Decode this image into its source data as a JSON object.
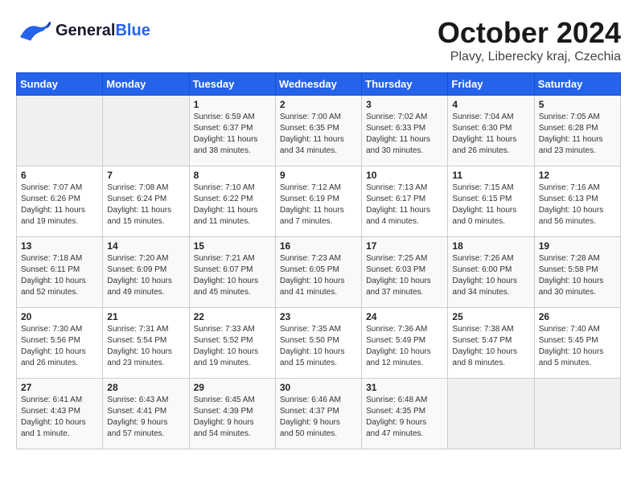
{
  "header": {
    "logo_line1": "General",
    "logo_line2": "Blue",
    "month": "October 2024",
    "location": "Plavy, Liberecky kraj, Czechia"
  },
  "weekdays": [
    "Sunday",
    "Monday",
    "Tuesday",
    "Wednesday",
    "Thursday",
    "Friday",
    "Saturday"
  ],
  "weeks": [
    [
      {
        "day": "",
        "info": ""
      },
      {
        "day": "",
        "info": ""
      },
      {
        "day": "1",
        "info": "Sunrise: 6:59 AM\nSunset: 6:37 PM\nDaylight: 11 hours\nand 38 minutes."
      },
      {
        "day": "2",
        "info": "Sunrise: 7:00 AM\nSunset: 6:35 PM\nDaylight: 11 hours\nand 34 minutes."
      },
      {
        "day": "3",
        "info": "Sunrise: 7:02 AM\nSunset: 6:33 PM\nDaylight: 11 hours\nand 30 minutes."
      },
      {
        "day": "4",
        "info": "Sunrise: 7:04 AM\nSunset: 6:30 PM\nDaylight: 11 hours\nand 26 minutes."
      },
      {
        "day": "5",
        "info": "Sunrise: 7:05 AM\nSunset: 6:28 PM\nDaylight: 11 hours\nand 23 minutes."
      }
    ],
    [
      {
        "day": "6",
        "info": "Sunrise: 7:07 AM\nSunset: 6:26 PM\nDaylight: 11 hours\nand 19 minutes."
      },
      {
        "day": "7",
        "info": "Sunrise: 7:08 AM\nSunset: 6:24 PM\nDaylight: 11 hours\nand 15 minutes."
      },
      {
        "day": "8",
        "info": "Sunrise: 7:10 AM\nSunset: 6:22 PM\nDaylight: 11 hours\nand 11 minutes."
      },
      {
        "day": "9",
        "info": "Sunrise: 7:12 AM\nSunset: 6:19 PM\nDaylight: 11 hours\nand 7 minutes."
      },
      {
        "day": "10",
        "info": "Sunrise: 7:13 AM\nSunset: 6:17 PM\nDaylight: 11 hours\nand 4 minutes."
      },
      {
        "day": "11",
        "info": "Sunrise: 7:15 AM\nSunset: 6:15 PM\nDaylight: 11 hours\nand 0 minutes."
      },
      {
        "day": "12",
        "info": "Sunrise: 7:16 AM\nSunset: 6:13 PM\nDaylight: 10 hours\nand 56 minutes."
      }
    ],
    [
      {
        "day": "13",
        "info": "Sunrise: 7:18 AM\nSunset: 6:11 PM\nDaylight: 10 hours\nand 52 minutes."
      },
      {
        "day": "14",
        "info": "Sunrise: 7:20 AM\nSunset: 6:09 PM\nDaylight: 10 hours\nand 49 minutes."
      },
      {
        "day": "15",
        "info": "Sunrise: 7:21 AM\nSunset: 6:07 PM\nDaylight: 10 hours\nand 45 minutes."
      },
      {
        "day": "16",
        "info": "Sunrise: 7:23 AM\nSunset: 6:05 PM\nDaylight: 10 hours\nand 41 minutes."
      },
      {
        "day": "17",
        "info": "Sunrise: 7:25 AM\nSunset: 6:03 PM\nDaylight: 10 hours\nand 37 minutes."
      },
      {
        "day": "18",
        "info": "Sunrise: 7:26 AM\nSunset: 6:00 PM\nDaylight: 10 hours\nand 34 minutes."
      },
      {
        "day": "19",
        "info": "Sunrise: 7:28 AM\nSunset: 5:58 PM\nDaylight: 10 hours\nand 30 minutes."
      }
    ],
    [
      {
        "day": "20",
        "info": "Sunrise: 7:30 AM\nSunset: 5:56 PM\nDaylight: 10 hours\nand 26 minutes."
      },
      {
        "day": "21",
        "info": "Sunrise: 7:31 AM\nSunset: 5:54 PM\nDaylight: 10 hours\nand 23 minutes."
      },
      {
        "day": "22",
        "info": "Sunrise: 7:33 AM\nSunset: 5:52 PM\nDaylight: 10 hours\nand 19 minutes."
      },
      {
        "day": "23",
        "info": "Sunrise: 7:35 AM\nSunset: 5:50 PM\nDaylight: 10 hours\nand 15 minutes."
      },
      {
        "day": "24",
        "info": "Sunrise: 7:36 AM\nSunset: 5:49 PM\nDaylight: 10 hours\nand 12 minutes."
      },
      {
        "day": "25",
        "info": "Sunrise: 7:38 AM\nSunset: 5:47 PM\nDaylight: 10 hours\nand 8 minutes."
      },
      {
        "day": "26",
        "info": "Sunrise: 7:40 AM\nSunset: 5:45 PM\nDaylight: 10 hours\nand 5 minutes."
      }
    ],
    [
      {
        "day": "27",
        "info": "Sunrise: 6:41 AM\nSunset: 4:43 PM\nDaylight: 10 hours\nand 1 minute."
      },
      {
        "day": "28",
        "info": "Sunrise: 6:43 AM\nSunset: 4:41 PM\nDaylight: 9 hours\nand 57 minutes."
      },
      {
        "day": "29",
        "info": "Sunrise: 6:45 AM\nSunset: 4:39 PM\nDaylight: 9 hours\nand 54 minutes."
      },
      {
        "day": "30",
        "info": "Sunrise: 6:46 AM\nSunset: 4:37 PM\nDaylight: 9 hours\nand 50 minutes."
      },
      {
        "day": "31",
        "info": "Sunrise: 6:48 AM\nSunset: 4:35 PM\nDaylight: 9 hours\nand 47 minutes."
      },
      {
        "day": "",
        "info": ""
      },
      {
        "day": "",
        "info": ""
      }
    ]
  ]
}
